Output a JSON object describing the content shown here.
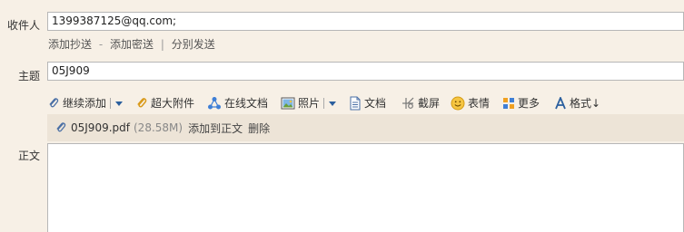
{
  "recipient": {
    "label": "收件人",
    "value": "1399387125@qq.com;"
  },
  "recipient_links": {
    "cc": "添加抄送",
    "sep1": "-",
    "bcc": "添加密送",
    "sep2": "|",
    "separate": "分别发送"
  },
  "subject": {
    "label": "主题",
    "value": "05J909"
  },
  "toolbar": {
    "continue_add": "继续添加",
    "large_attachment": "超大附件",
    "online_doc": "在线文档",
    "photo": "照片",
    "document": "文档",
    "screenshot": "截屏",
    "emoji": "表情",
    "more": "更多",
    "format": "格式↓"
  },
  "attachment": {
    "filename": "05J909.pdf",
    "size": "(28.58M)",
    "add_to_body": "添加到正文",
    "delete": "删除"
  },
  "body": {
    "label": "正文",
    "content": ""
  }
}
